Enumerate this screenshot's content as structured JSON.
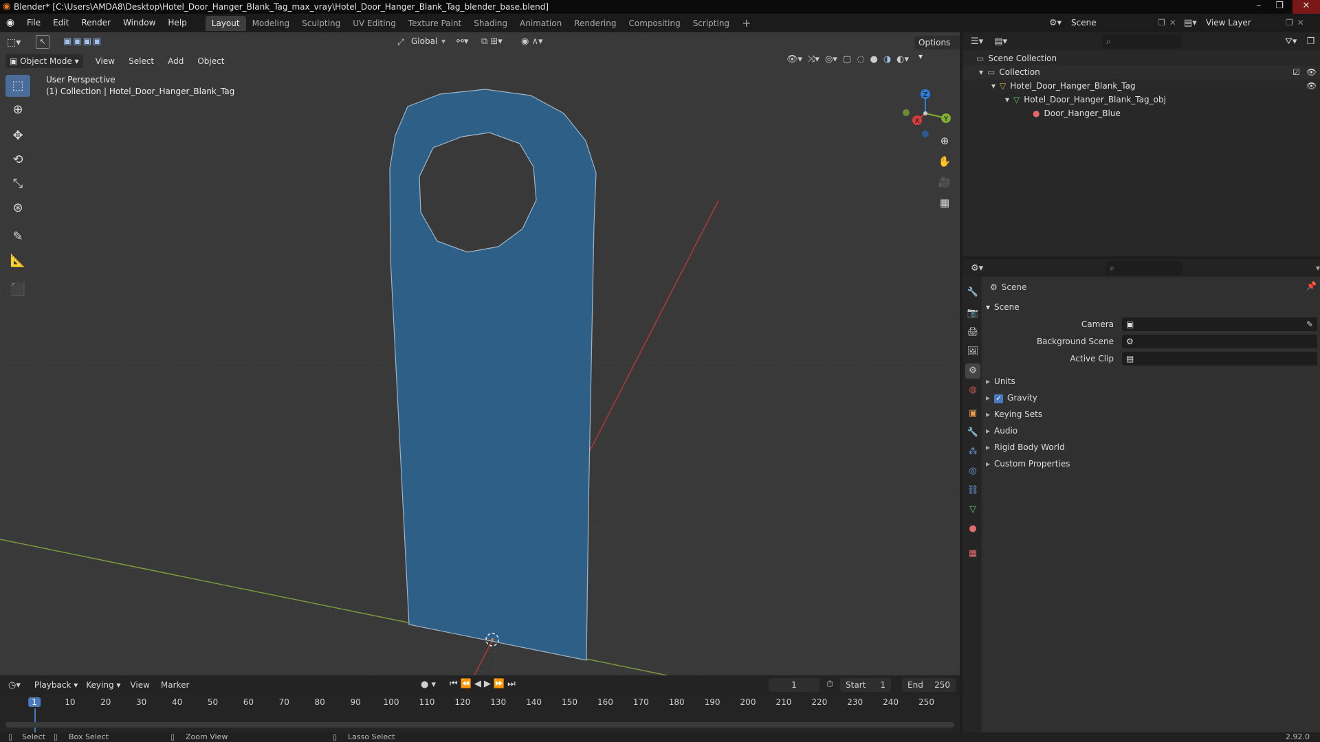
{
  "titlebar": {
    "title": "Blender* [C:\\Users\\AMDA8\\Desktop\\Hotel_Door_Hanger_Blank_Tag_max_vray\\Hotel_Door_Hanger_Blank_Tag_blender_base.blend]"
  },
  "menu": [
    "File",
    "Edit",
    "Render",
    "Window",
    "Help"
  ],
  "workspaces": [
    "Layout",
    "Modeling",
    "Sculpting",
    "UV Editing",
    "Texture Paint",
    "Shading",
    "Animation",
    "Rendering",
    "Compositing",
    "Scripting"
  ],
  "scene_selector": "Scene",
  "view_layer": "View Layer",
  "viewport": {
    "transform_orientation": "Global",
    "options_label": "Options",
    "mode": "Object Mode",
    "menus": [
      "View",
      "Select",
      "Add",
      "Object"
    ],
    "overlay_title": "User Perspective",
    "overlay_subtitle": "(1) Collection | Hotel_Door_Hanger_Blank_Tag",
    "gizmo": {
      "x": "X",
      "y": "Y",
      "z": "Z"
    },
    "colors": {
      "bg": "#3a3a3a",
      "object": "#2e5f86",
      "x_axis": "#b03a3a",
      "y_axis": "#7a9a3a"
    }
  },
  "outliner": {
    "rows": [
      {
        "label": "Scene Collection"
      },
      {
        "label": "Collection"
      },
      {
        "label": "Hotel_Door_Hanger_Blank_Tag"
      },
      {
        "label": "Hotel_Door_Hanger_Blank_Tag_obj"
      },
      {
        "label": "Door_Hanger_Blue"
      }
    ]
  },
  "properties": {
    "header": "Scene",
    "panel": "Scene",
    "fields": [
      {
        "label": "Camera"
      },
      {
        "label": "Background Scene"
      },
      {
        "label": "Active Clip"
      }
    ],
    "sections": [
      "Units",
      "Gravity",
      "Keying Sets",
      "Audio",
      "Rigid Body World",
      "Custom Properties"
    ],
    "gravity_checked": true
  },
  "timeline": {
    "menus": [
      "Playback",
      "Keying",
      "View",
      "Marker"
    ],
    "current_frame": "1",
    "start_label": "Start",
    "start": "1",
    "end_label": "End",
    "end": "250",
    "ruler": [
      "1",
      "10",
      "20",
      "30",
      "40",
      "50",
      "60",
      "70",
      "80",
      "90",
      "100",
      "110",
      "120",
      "130",
      "140",
      "150",
      "160",
      "170",
      "180",
      "190",
      "200",
      "210",
      "220",
      "230",
      "240",
      "250"
    ]
  },
  "statusbar": {
    "select": "Select",
    "box_select": "Box Select",
    "zoom_view": "Zoom View",
    "lasso_select": "Lasso Select",
    "version": "2.92.0"
  }
}
